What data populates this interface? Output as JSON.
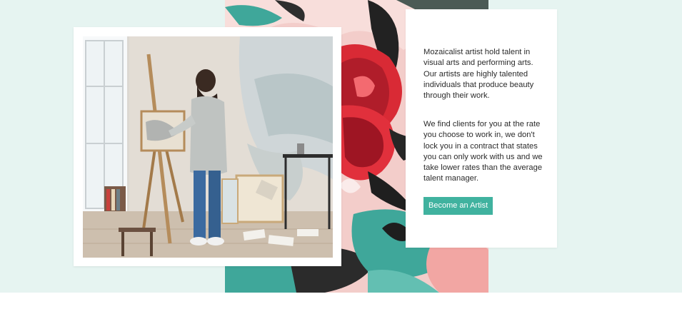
{
  "about_section": {
    "paragraph_1": "Mozaicalist artist hold talent in visual arts and performing arts. Our artists are highly talented individuals that produce beauty through their work.",
    "paragraph_2": "We find clients for you at the rate you choose to work in, we don't lock you in a contract that states you can only work with us and we take lower rates than the average talent manager.",
    "cta_label": "Become an Artist"
  },
  "colors": {
    "section_background": "#e6f4f1",
    "accent": "#40b29f",
    "text": "#2b2b2b"
  },
  "images": {
    "photo": "artist-painting-at-easel-photo",
    "background": "floral-painting-mural"
  }
}
